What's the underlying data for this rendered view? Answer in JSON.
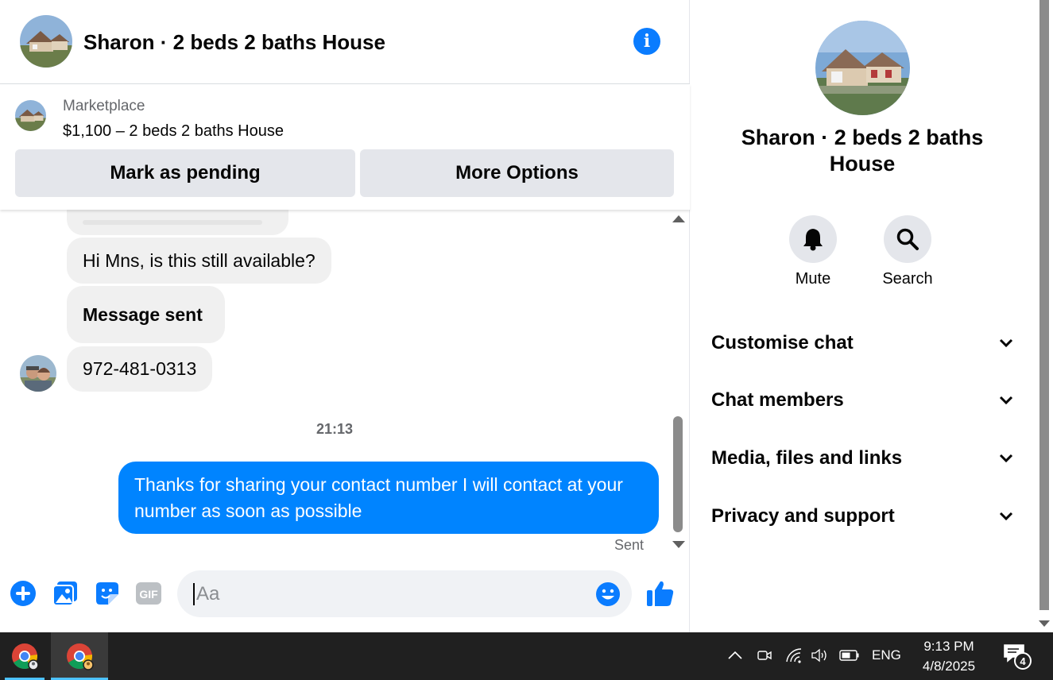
{
  "chat": {
    "title": "Sharon · 2 beds 2 baths House",
    "listing": {
      "source": "Marketplace",
      "price_title": "$1,100 – 2 beds 2 baths House",
      "mark_pending_label": "Mark as pending",
      "more_options_label": "More Options"
    },
    "messages": [
      {
        "direction": "incoming",
        "text": "Hi Mns, is this still available?"
      },
      {
        "direction": "incoming",
        "text": "Message sent"
      },
      {
        "direction": "incoming",
        "text": "972-481-0313"
      }
    ],
    "timestamp": "21:13",
    "outgoing": {
      "text": "Thanks for sharing your contact number I will contact at your number as soon as possible",
      "status": "Sent"
    },
    "composer": {
      "placeholder": "Aa",
      "icons": [
        "plus-circle-icon",
        "photo-icon",
        "sticker-icon",
        "gif-icon",
        "emoji-icon",
        "thumbs-up-icon"
      ],
      "gif_label": "GIF"
    }
  },
  "panel": {
    "title": "Sharon · 2 beds 2 baths House",
    "actions": [
      {
        "label": "Mute",
        "icon": "bell-icon"
      },
      {
        "label": "Search",
        "icon": "search-icon"
      }
    ],
    "sections": [
      "Customise chat",
      "Chat members",
      "Media, files and links",
      "Privacy and support"
    ]
  },
  "taskbar": {
    "apps": [
      "chrome-icon",
      "chrome-icon"
    ],
    "tray_icons": [
      "chevron-up-icon",
      "meet-icon",
      "wifi-icon",
      "volume-icon",
      "battery-icon"
    ],
    "language": "ENG",
    "time": "9:13 PM",
    "date": "4/8/2025",
    "notification_count": "4"
  },
  "colors": {
    "messenger_blue": "#0084ff",
    "icon_blue": "#0a7cff",
    "bubble_gray": "#f0f0f0",
    "button_gray": "#e4e6eb",
    "taskbar": "#202020"
  }
}
